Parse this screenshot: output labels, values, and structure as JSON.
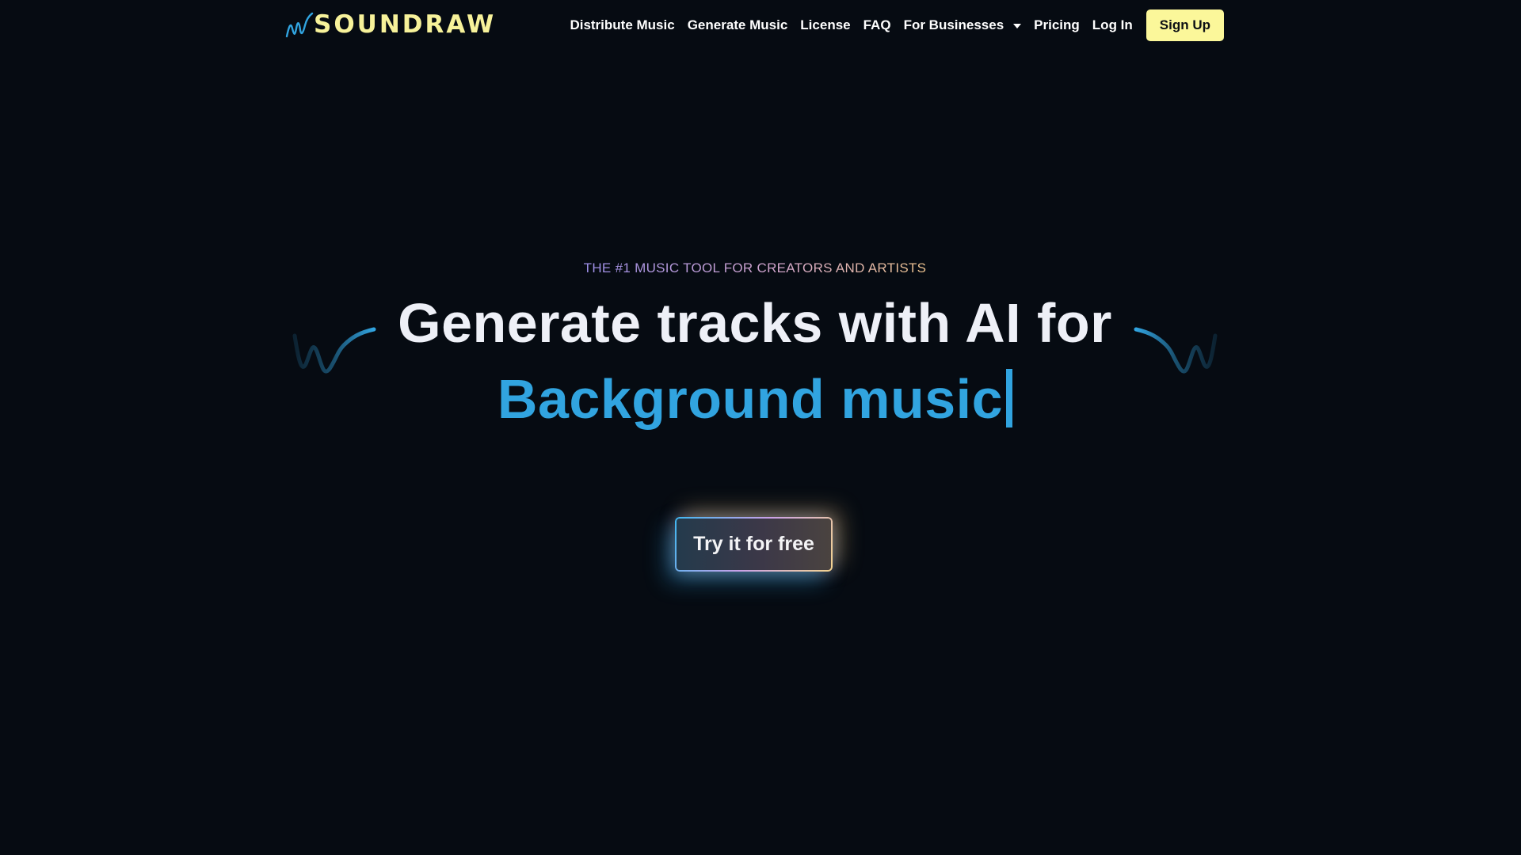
{
  "brand": {
    "name": "SOUNDRAW",
    "logo_color": "#f7f29a",
    "accent_color": "#31a4e0"
  },
  "nav": {
    "items": [
      {
        "label": "Distribute Music"
      },
      {
        "label": "Generate Music"
      },
      {
        "label": "License"
      },
      {
        "label": "FAQ"
      },
      {
        "label": "For Businesses",
        "icon": "chevron-down-icon"
      },
      {
        "label": "Pricing"
      },
      {
        "label": "Log In"
      }
    ],
    "signup_label": "Sign Up",
    "signup_color": "#fbf79a"
  },
  "hero": {
    "eyebrow": "THE #1 MUSIC TOOL FOR CREATORS AND ARTISTS",
    "headline": "Generate tracks with AI for",
    "rotating_text": "Background music",
    "cta_label": "Try it for free"
  },
  "decorations": {
    "left_icon": "wave-icon",
    "right_icon": "wave-icon"
  }
}
